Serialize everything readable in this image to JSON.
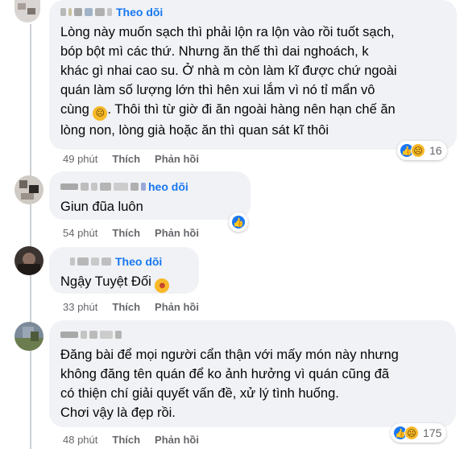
{
  "comments": [
    {
      "author": "",
      "follow_label": "Theo dõi",
      "text": "Lòng này muốn sạch thì phải lộn ra lộn vào rồi tuốt sạch,\nbóp bột mì các thứ. Nhưng ăn thế thì dai nghoách, k\nkhác gì nhai cao su. Ở nhà m còn làm kĩ được chứ ngoài\nquán làm số lượng lớn thì hên xui lắm vì nó tỉ mẩn vô\ncùng",
      "text_after_emoji": ". Thôi thì từ giờ đi ăn ngoài hàng nên hạn chế ăn\nlòng non, lòng già hoặc ăn thì quan sát kĩ thôi",
      "inline_emoji": "sad-face",
      "time": "49 phút",
      "like_label": "Thích",
      "reply_label": "Phản hồi",
      "reactions": [
        "like",
        "sad"
      ],
      "reaction_count": "16"
    },
    {
      "author": "",
      "follow_label": "heo dõi",
      "text": "Giun đũa luôn",
      "time": "54 phút",
      "like_label": "Thích",
      "reply_label": "Phản hồi",
      "reactions": [
        "like"
      ],
      "reaction_count": ""
    },
    {
      "author": "",
      "follow_label": "Theo dõi",
      "text": "Ngậy Tuyệt Đối",
      "inline_emoji": "tongue-face",
      "time": "33 phút",
      "like_label": "Thích",
      "reply_label": "Phản hồi",
      "reactions": [],
      "reaction_count": ""
    },
    {
      "author": "",
      "follow_label": "",
      "text": "Đăng bài để mọi người cẩn thận với mấy món này nhưng\nkhông đăng tên quán để ko ảnh hưởng vì quán cũng đã\ncó thiện chí giải quyết vấn đề, xử lý tình huống.\nChơi vậy là đẹp rồi.",
      "time": "48 phút",
      "like_label": "Thích",
      "reply_label": "Phản hồi",
      "reactions": [
        "like",
        "sad"
      ],
      "reaction_count": "175"
    }
  ],
  "colors": {
    "bubble": "#f0f2f5",
    "link": "#1877f2",
    "meta": "#65676b",
    "like": "#1877f2",
    "sad": "#f7b928"
  }
}
